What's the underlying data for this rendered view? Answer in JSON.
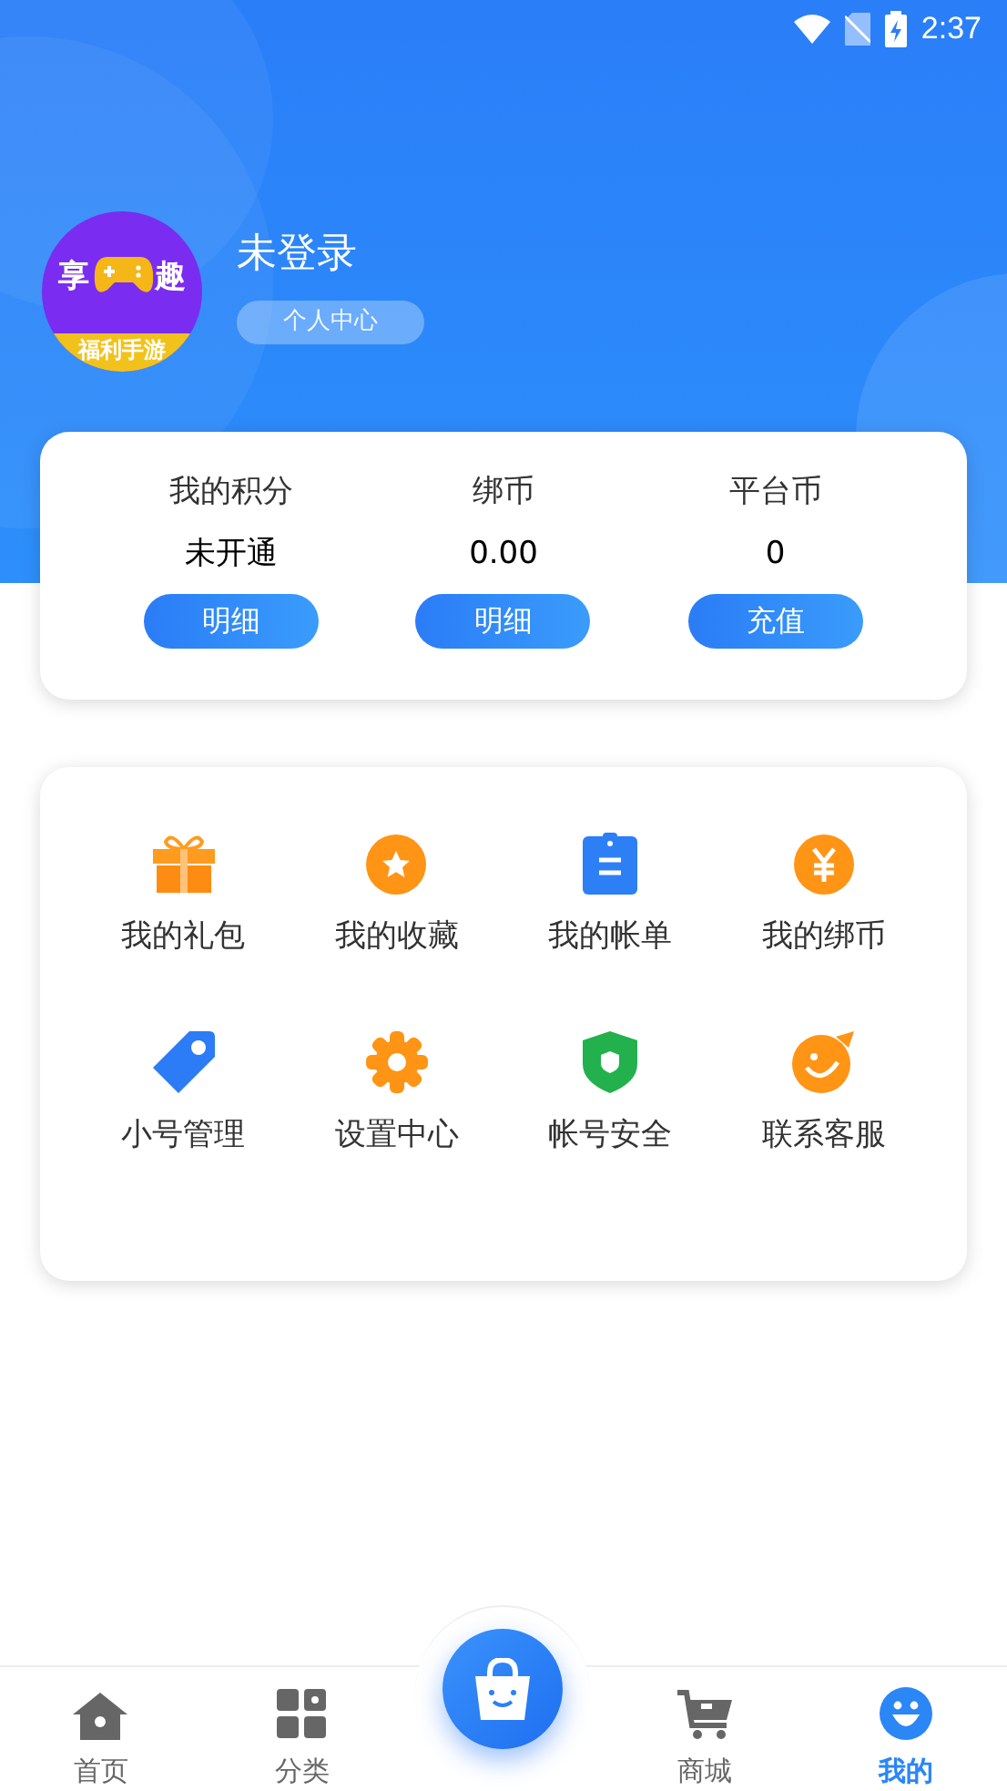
{
  "status_bar": {
    "time": "2:37"
  },
  "profile": {
    "avatar": {
      "left": "享",
      "right": "趣",
      "banner": "福利手游"
    },
    "name": "未登录",
    "link": "个人中心"
  },
  "wallet": [
    {
      "label": "我的积分",
      "value": "未开通",
      "button": "明细"
    },
    {
      "label": "绑币",
      "value": "0.00",
      "button": "明细"
    },
    {
      "label": "平台币",
      "value": "0",
      "button": "充值"
    }
  ],
  "menu": [
    {
      "kind": "gift",
      "label": "我的礼包"
    },
    {
      "kind": "star",
      "label": "我的收藏"
    },
    {
      "kind": "bill",
      "label": "我的帐单"
    },
    {
      "kind": "coin",
      "label": "我的绑币"
    },
    {
      "kind": "tag",
      "label": "小号管理"
    },
    {
      "kind": "gear",
      "label": "设置中心"
    },
    {
      "kind": "shield",
      "label": "帐号安全"
    },
    {
      "kind": "smile",
      "label": "联系客服"
    }
  ],
  "bottom_nav": [
    {
      "kind": "home",
      "label": "首页",
      "selected": false
    },
    {
      "kind": "grid",
      "label": "分类",
      "selected": false
    },
    {
      "kind": "bag"
    },
    {
      "kind": "cart",
      "label": "商城",
      "selected": false
    },
    {
      "kind": "face",
      "label": "我的",
      "selected": true
    }
  ]
}
